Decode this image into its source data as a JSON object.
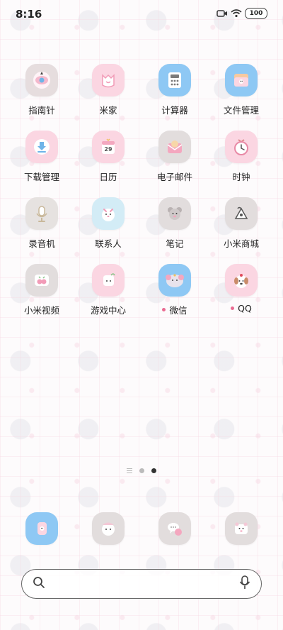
{
  "status_bar": {
    "time": "8:16",
    "battery": "100",
    "icons": [
      "screen-record-icon",
      "wifi-icon",
      "battery-icon"
    ]
  },
  "apps": [
    {
      "name": "compass",
      "label": "指南针",
      "icon": "compass-icon",
      "bg": "#e6ddde",
      "dot": false
    },
    {
      "name": "mi-home",
      "label": "米家",
      "icon": "mi-home-icon",
      "bg": "#fbd6e2",
      "dot": false
    },
    {
      "name": "calculator",
      "label": "计算器",
      "icon": "calculator-icon",
      "bg": "#8ec8f4",
      "dot": false
    },
    {
      "name": "file-manager",
      "label": "文件管理",
      "icon": "folder-icon",
      "bg": "#8ec8f4",
      "dot": false
    },
    {
      "name": "downloads",
      "label": "下载管理",
      "icon": "download-icon",
      "bg": "#fbd6e2",
      "dot": false
    },
    {
      "name": "calendar",
      "label": "日历",
      "icon": "calendar-icon",
      "bg": "#fbd6e2",
      "dot": false,
      "badge": "29"
    },
    {
      "name": "email",
      "label": "电子邮件",
      "icon": "mail-icon",
      "bg": "#e2dddd",
      "dot": false
    },
    {
      "name": "clock",
      "label": "时钟",
      "icon": "clock-icon",
      "bg": "#fbd6e2",
      "dot": false
    },
    {
      "name": "recorder",
      "label": "录音机",
      "icon": "microphone-icon",
      "bg": "#e6e2e0",
      "dot": false
    },
    {
      "name": "contacts",
      "label": "联系人",
      "icon": "contacts-icon",
      "bg": "#d3ecf6",
      "dot": false
    },
    {
      "name": "notes",
      "label": "笔记",
      "icon": "notes-icon",
      "bg": "#e2dddd",
      "dot": false
    },
    {
      "name": "mi-store",
      "label": "小米商城",
      "icon": "store-icon",
      "bg": "#e2dddd",
      "dot": false
    },
    {
      "name": "mi-video",
      "label": "小米视频",
      "icon": "video-icon",
      "bg": "#e2dddd",
      "dot": false
    },
    {
      "name": "game-center",
      "label": "游戏中心",
      "icon": "game-controller-icon",
      "bg": "#fbd6e2",
      "dot": false
    },
    {
      "name": "wechat",
      "label": "微信",
      "icon": "wechat-icon",
      "bg": "#8ec8f4",
      "dot": true
    },
    {
      "name": "qq",
      "label": "QQ",
      "icon": "qq-icon",
      "bg": "#fbd6e2",
      "dot": true
    }
  ],
  "page_indicator": {
    "pages": 2,
    "current": 2
  },
  "dock": [
    {
      "name": "phone",
      "icon": "phone-icon",
      "bg": "#8ec8f4"
    },
    {
      "name": "messages",
      "icon": "messages-icon",
      "bg": "#e2dddd"
    },
    {
      "name": "chat",
      "icon": "chat-bubble-icon",
      "bg": "#e2dddd"
    },
    {
      "name": "camera",
      "icon": "camera-icon",
      "bg": "#e2dddd"
    }
  ],
  "search": {
    "placeholder": "",
    "value": "",
    "left_icon": "search-icon",
    "right_icon": "microphone-icon"
  },
  "colors": {
    "accent_pink": "#ea6b92",
    "text": "#222222",
    "dot_active": "#333333",
    "dot_inactive": "#bbbbbb"
  }
}
